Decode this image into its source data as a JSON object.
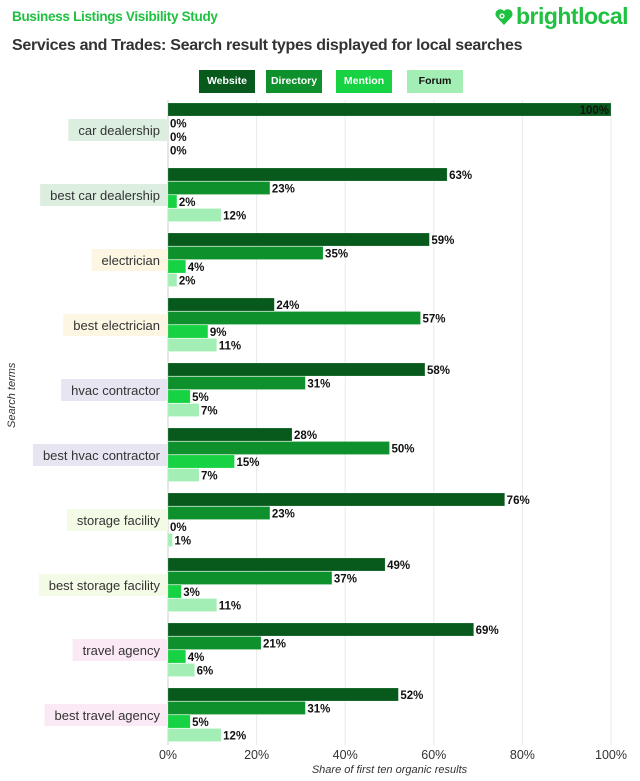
{
  "header": {
    "supertitle": "Business Listings Visibility Study",
    "brand": "brightlocal",
    "brand_color": "#1fc140",
    "title": "Services and Trades: Search result types displayed for local searches"
  },
  "chart_data": {
    "type": "bar",
    "orientation": "horizontal",
    "title": "Services and Trades: Search result types displayed for local searches",
    "xlabel": "Share of first ten organic results",
    "ylabel": "Search terms",
    "xlim": [
      0,
      100
    ],
    "x_ticks": [
      "0%",
      "20%",
      "40%",
      "60%",
      "80%",
      "100%"
    ],
    "grid": true,
    "legend_position": "top-center",
    "categories": [
      "car dealership",
      "best car dealership",
      "electrician",
      "best electrician",
      "hvac contractor",
      "best hvac contractor",
      "storage facility",
      "best storage facility",
      "travel agency",
      "best travel agency"
    ],
    "category_colors": [
      "#dbeee0",
      "#dbeee0",
      "#fcf6e3",
      "#fcf6e3",
      "#e8e5f3",
      "#e8e5f3",
      "#f3fbe6",
      "#f3fbe6",
      "#fbeaf5",
      "#fbeaf5"
    ],
    "series": [
      {
        "name": "Website",
        "color": "#075a1c",
        "text_color": "#ffffff",
        "values": [
          100,
          63,
          59,
          24,
          58,
          28,
          76,
          49,
          69,
          52
        ]
      },
      {
        "name": "Directory",
        "color": "#0e912c",
        "text_color": "#ffffff",
        "values": [
          0,
          23,
          35,
          57,
          31,
          50,
          23,
          37,
          21,
          31
        ]
      },
      {
        "name": "Mention",
        "color": "#17d242",
        "text_color": "#ffffff",
        "values": [
          0,
          2,
          4,
          9,
          5,
          15,
          0,
          3,
          4,
          5
        ]
      },
      {
        "name": "Forum",
        "color": "#a3eeb5",
        "text_color": "#111111",
        "values": [
          0,
          12,
          2,
          11,
          7,
          7,
          1,
          11,
          6,
          12
        ]
      }
    ]
  }
}
